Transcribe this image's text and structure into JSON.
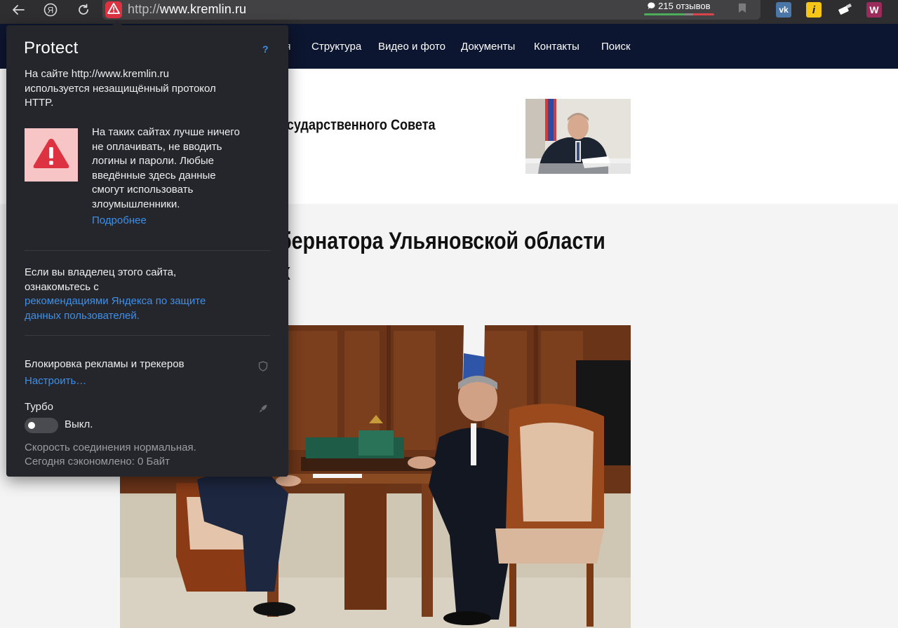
{
  "browser": {
    "url_scheme": "http://",
    "url_host": "www.kremlin.ru",
    "reviews_label": "215 отзывов",
    "extensions": [
      {
        "name": "vk",
        "label": "vk",
        "color": "#4a76a8"
      },
      {
        "name": "i",
        "label": "i",
        "color": "#f5c518"
      },
      {
        "name": "w",
        "label": "W",
        "color": "#9b2b5a"
      }
    ]
  },
  "site_nav": {
    "items": [
      "ия",
      "Структура",
      "Видео и фото",
      "Документы",
      "Контакты",
      "Поиск"
    ]
  },
  "news": {
    "item1_title": "осударственного Совета",
    "item2_title_line1": "бернатора Ульяновской области",
    "item2_title_line2": "х"
  },
  "protect": {
    "logo": "Protect",
    "help": "?",
    "intro_line1": "На сайте http://www.kremlin.ru",
    "intro_line2": "используется незащищённый протокол",
    "intro_line3": "HTTP.",
    "warning_lines": [
      "На таких сайтах лучше ничего",
      "не оплачивать, не вводить",
      "логины и пароли. Любые",
      "введённые здесь данные",
      "смогут использовать",
      "злоумышленники."
    ],
    "more_link": "Подробнее",
    "owner_line1": "Если вы владелец этого сайта,",
    "owner_line2": "ознакомьтесь с",
    "owner_link_line1": "рекомендациями Яндекса по защите",
    "owner_link_line2": "данных пользователей.",
    "adblock_label": "Блокировка рекламы и трекеров",
    "adblock_link": "Настроить…",
    "turbo_label": "Турбо",
    "turbo_state": "Выкл.",
    "speed_status": "Скорость соединения нормальная.",
    "saved_status": "Сегодня сэкономлено: 0 Байт"
  },
  "colors": {
    "popup_bg": "#25262b",
    "link": "#3f8fe6",
    "warning": "#dd3241",
    "site_header": "#0d1630"
  }
}
